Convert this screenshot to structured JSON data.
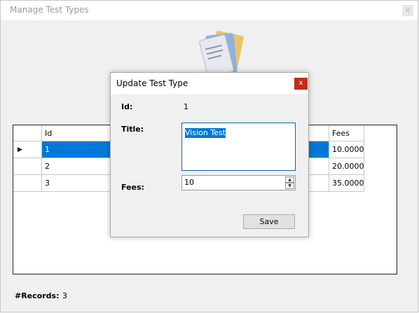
{
  "main_window": {
    "title": "Manage Test Types",
    "close_glyph": "×"
  },
  "grid": {
    "columns": [
      "Id",
      "Fees"
    ],
    "rows": [
      {
        "id": "1",
        "fees": "10.0000"
      },
      {
        "id": "2",
        "fees": "20.0000"
      },
      {
        "id": "3",
        "fees": "35.0000"
      }
    ],
    "selected_row_index": 0,
    "row_indicator": "▶"
  },
  "footer": {
    "records_label": "#Records:",
    "records_value": "3"
  },
  "dialog": {
    "title": "Update Test Type",
    "close_glyph": "x",
    "close_color": "#c42b1c",
    "id_label": "Id:",
    "id_value": "1",
    "title_label": "Title:",
    "title_value": "Vision Test",
    "fees_label": "Fees:",
    "fees_value": "10",
    "save_label": "Save"
  },
  "icons": {
    "up_arrow": "▲",
    "down_arrow": "▼"
  },
  "colors": {
    "selection": "#0078d7",
    "background": "#f0f0f0"
  }
}
